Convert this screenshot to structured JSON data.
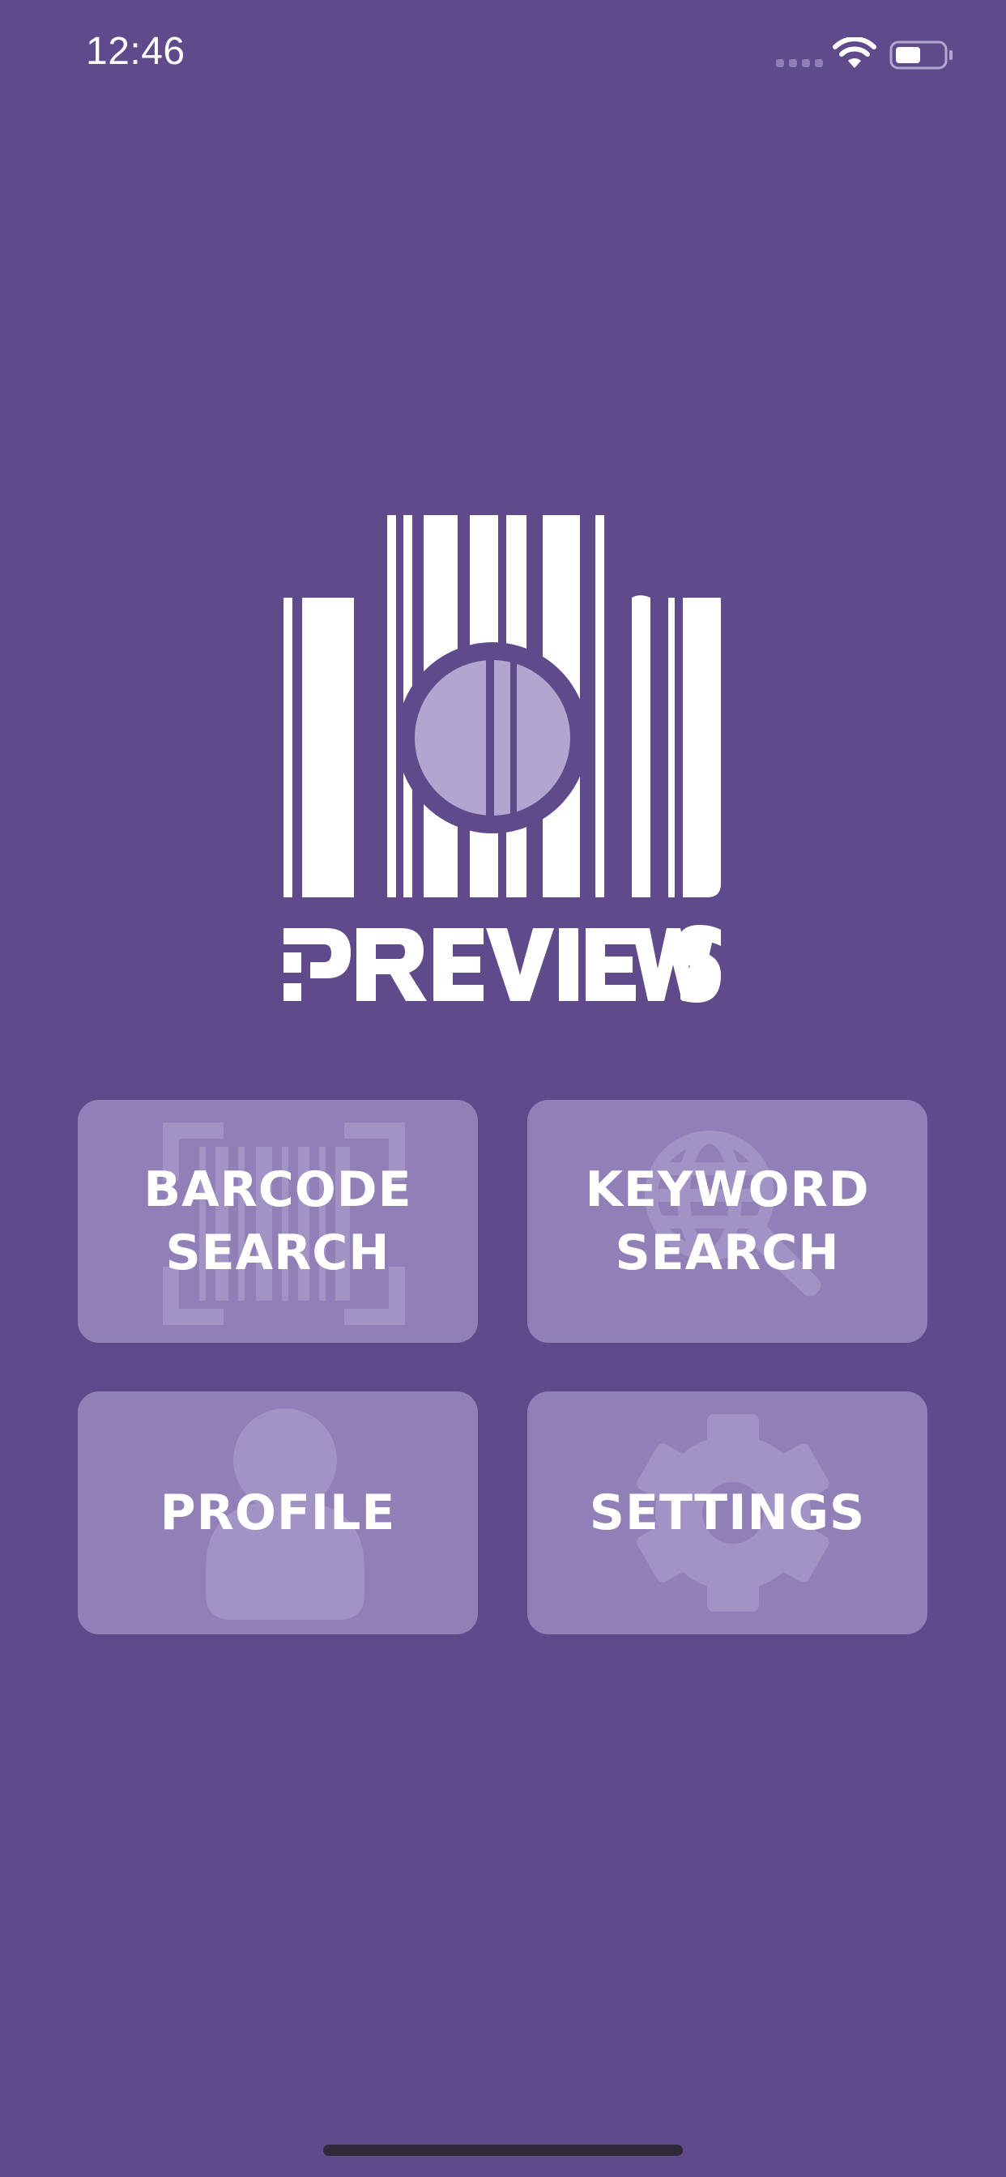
{
  "status_bar": {
    "time": "12:46"
  },
  "logo": {
    "name": "PREVIEWS"
  },
  "menu": {
    "barcode": {
      "line1": "BARCODE",
      "line2": "SEARCH"
    },
    "keyword": {
      "line1": "KEYWORD",
      "line2": "SEARCH"
    },
    "profile": {
      "label": "PROFILE"
    },
    "settings": {
      "label": "SETTINGS"
    }
  },
  "icons": {
    "barcode_tile": "barcode-scan-icon",
    "keyword_tile": "globe-search-icon",
    "profile_tile": "person-icon",
    "settings_tile": "gear-icon"
  },
  "colors": {
    "background": "#5f4b8b",
    "tile": "#9080b7",
    "tile_icon": "#a193c3",
    "text": "#ffffff"
  }
}
